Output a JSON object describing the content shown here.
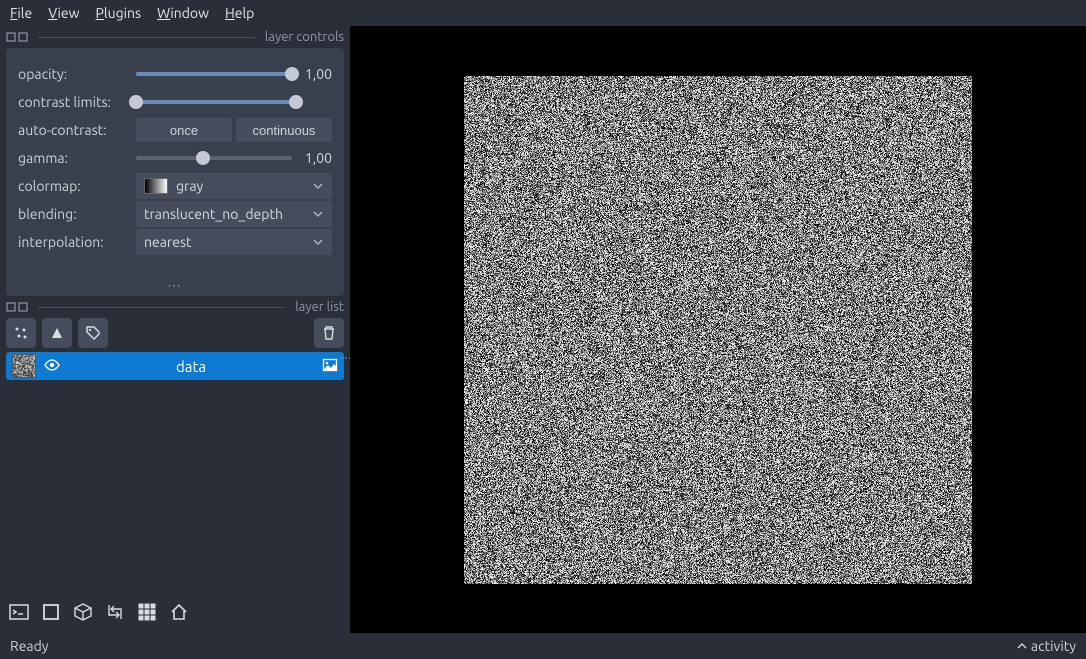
{
  "menu": {
    "file": "File",
    "view": "View",
    "plugins": "Plugins",
    "window": "Window",
    "help": "Help"
  },
  "panels": {
    "layer_controls_title": "layer controls",
    "layer_list_title": "layer list"
  },
  "controls": {
    "opacity_label": "opacity:",
    "opacity_value": "1,00",
    "contrast_label": "contrast limits:",
    "autocontrast_label": "auto-contrast:",
    "autocontrast_once": "once",
    "autocontrast_continuous": "continuous",
    "gamma_label": "gamma:",
    "gamma_value": "1,00",
    "colormap_label": "colormap:",
    "colormap_value": "gray",
    "blending_label": "blending:",
    "blending_value": "translucent_no_depth",
    "interpolation_label": "interpolation:",
    "interpolation_value": "nearest"
  },
  "layer": {
    "name": "data"
  },
  "status": {
    "ready": "Ready",
    "activity": "activity"
  }
}
